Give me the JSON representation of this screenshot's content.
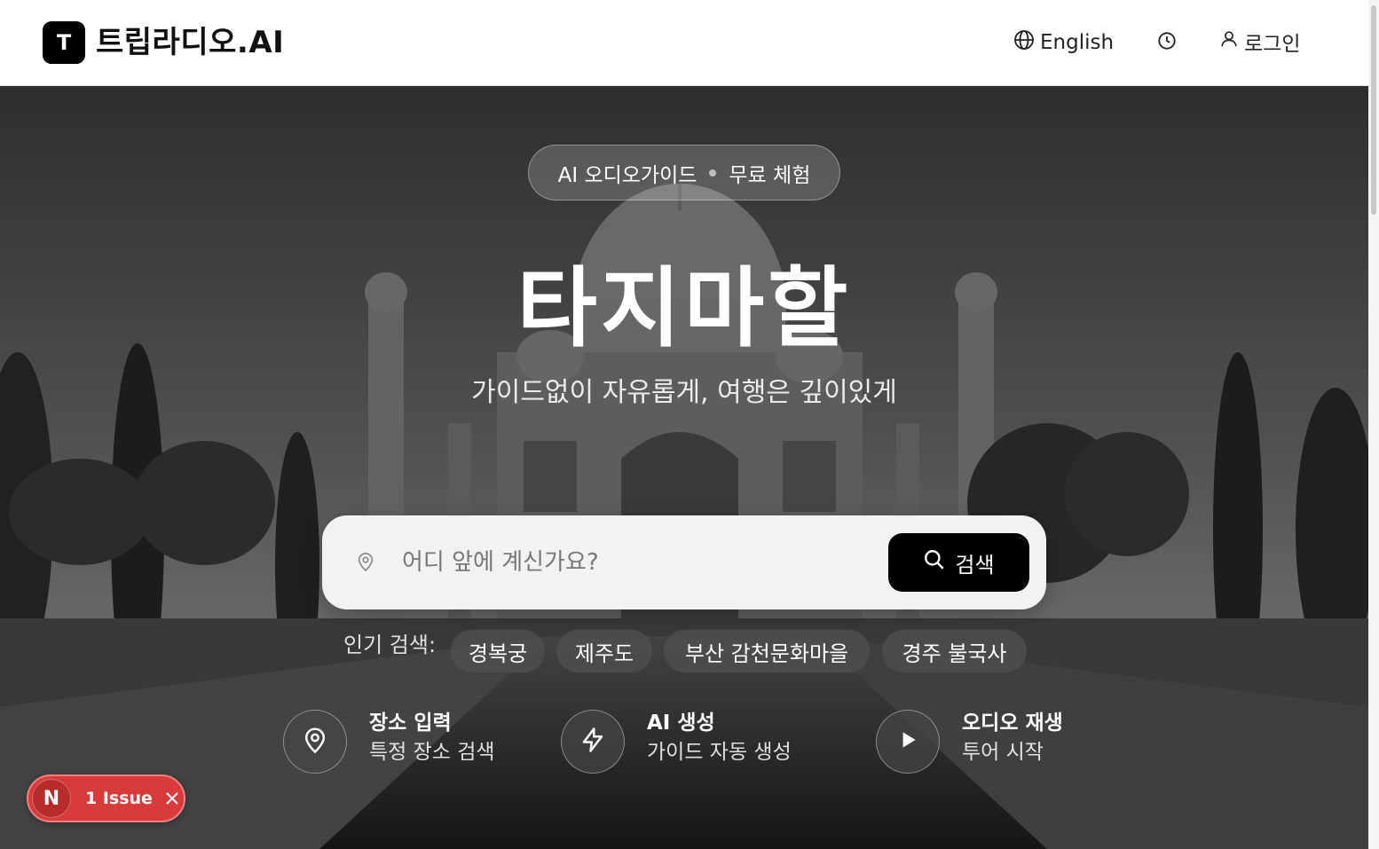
{
  "header": {
    "logo_letter": "T",
    "logo_text": "트립라디오.AI",
    "language_label": "English",
    "login_label": "로그인"
  },
  "hero": {
    "badge_left": "AI 오디오가이드",
    "badge_right": "무료 체험",
    "title": "타지마할",
    "subtitle": "가이드없이 자유롭게, 여행은 깊이있게"
  },
  "search": {
    "placeholder": "어디 앞에 계신가요?",
    "button_label": "검색"
  },
  "popular": {
    "label": "인기 검색:",
    "items": [
      "경복궁",
      "제주도",
      "부산 감천문화마을",
      "경주 불국사"
    ]
  },
  "features": [
    {
      "title": "장소 입력",
      "desc": "특정 장소 검색",
      "icon": "map-pin-icon"
    },
    {
      "title": "AI 생성",
      "desc": "가이드 자동 생성",
      "icon": "lightning-icon"
    },
    {
      "title": "오디오 재생",
      "desc": "투어 시작",
      "icon": "play-icon"
    }
  ],
  "dev_overlay": {
    "letter": "N",
    "issue_label": "1 Issue"
  },
  "colors": {
    "primary": "#000000",
    "issue_red": "#d93a3a"
  }
}
